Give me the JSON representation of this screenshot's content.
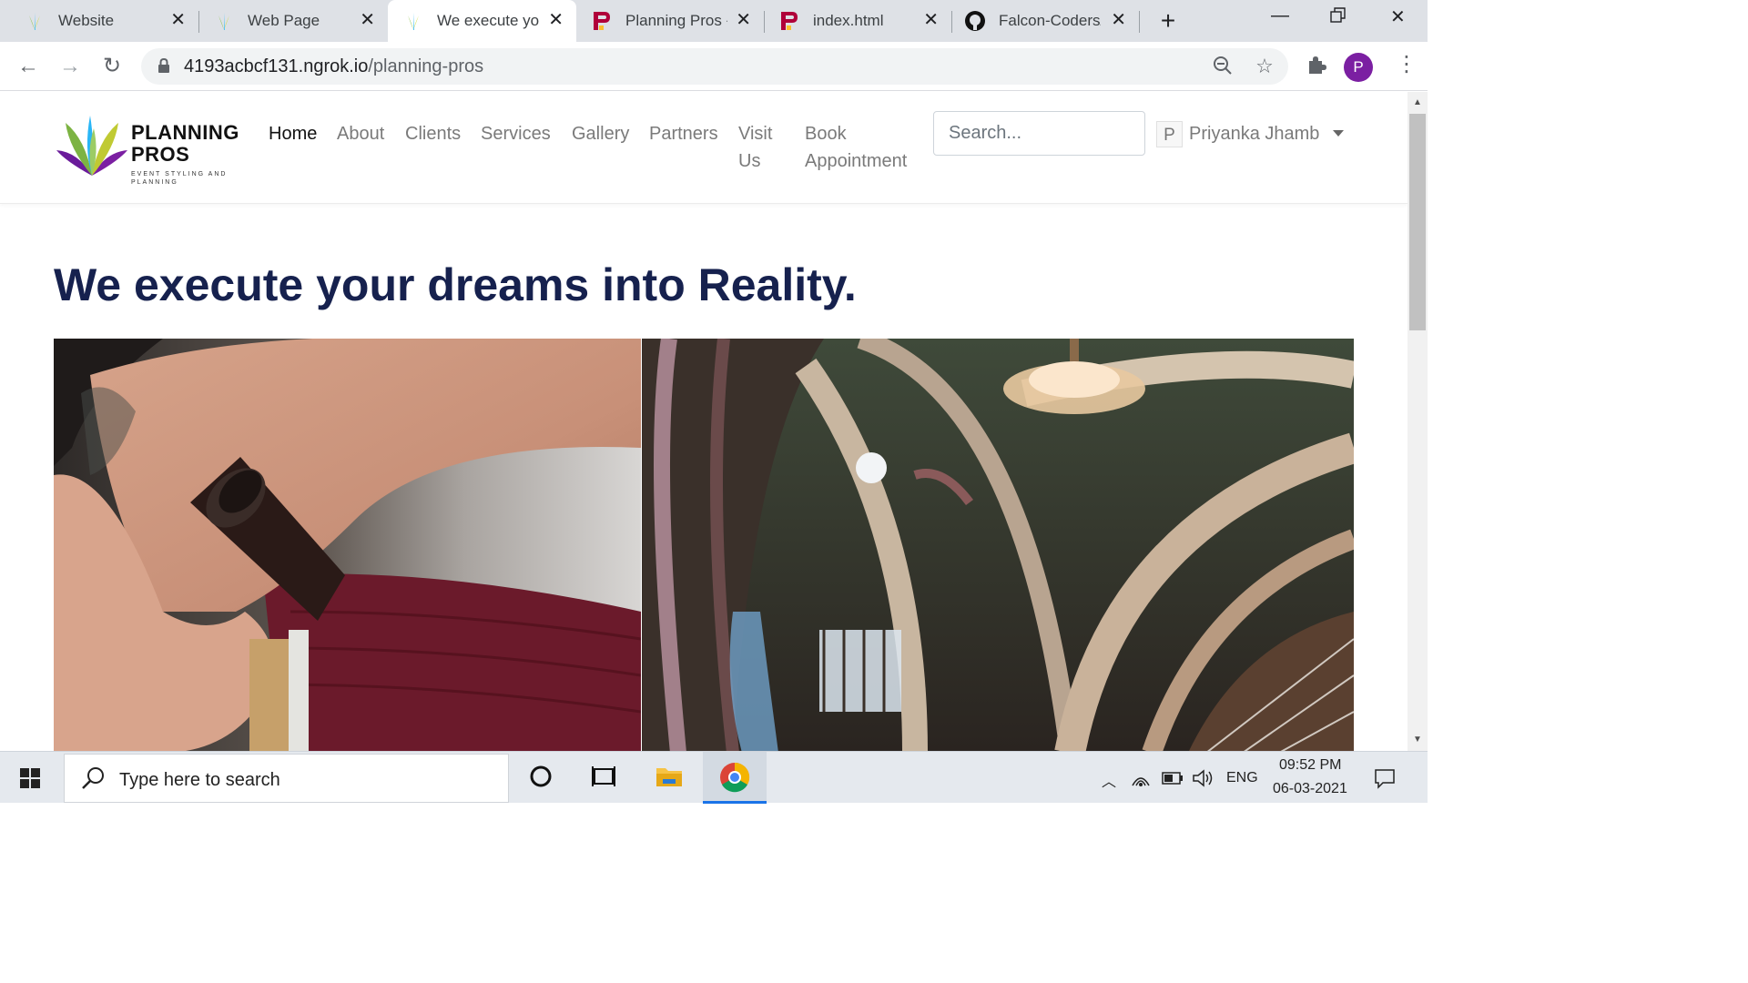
{
  "browser": {
    "tabs": [
      {
        "title": "Website",
        "favicon": "lotus-icon",
        "active": false
      },
      {
        "title": "Web Page",
        "favicon": "lotus-icon",
        "active": false
      },
      {
        "title": "We execute your",
        "favicon": "lotus-icon",
        "active": true
      },
      {
        "title": "Planning Pros -",
        "favicon": "p-logo-icon",
        "active": false
      },
      {
        "title": "index.html",
        "favicon": "p-logo-icon",
        "active": false
      },
      {
        "title": "Falcon-Coders/",
        "favicon": "github-icon",
        "active": false
      }
    ],
    "url_host": "4193acbcf131.ngrok.io",
    "url_path": "/planning-pros",
    "profile_initial": "P",
    "accent_profile": "#7b1fa2"
  },
  "site": {
    "brand_line1": "PLANNING",
    "brand_line2": "PROS",
    "brand_tagline": "EVENT STYLING AND PLANNING",
    "nav": [
      {
        "label": "Home",
        "active": true
      },
      {
        "label": "About"
      },
      {
        "label": "Clients"
      },
      {
        "label": "Services"
      },
      {
        "label": "Gallery"
      },
      {
        "label": "Partners"
      },
      {
        "label": "Visit Us"
      },
      {
        "label": "Book Appointment"
      }
    ],
    "search_placeholder": "Search...",
    "user_initial": "P",
    "user_name": "Priyanka Jhamb",
    "hero_title": "We execute your dreams into Reality.",
    "title_color": "#16214e"
  },
  "taskbar": {
    "search_placeholder": "Type here to search",
    "language": "ENG",
    "time": "09:52 PM",
    "date": "06-03-2021"
  }
}
